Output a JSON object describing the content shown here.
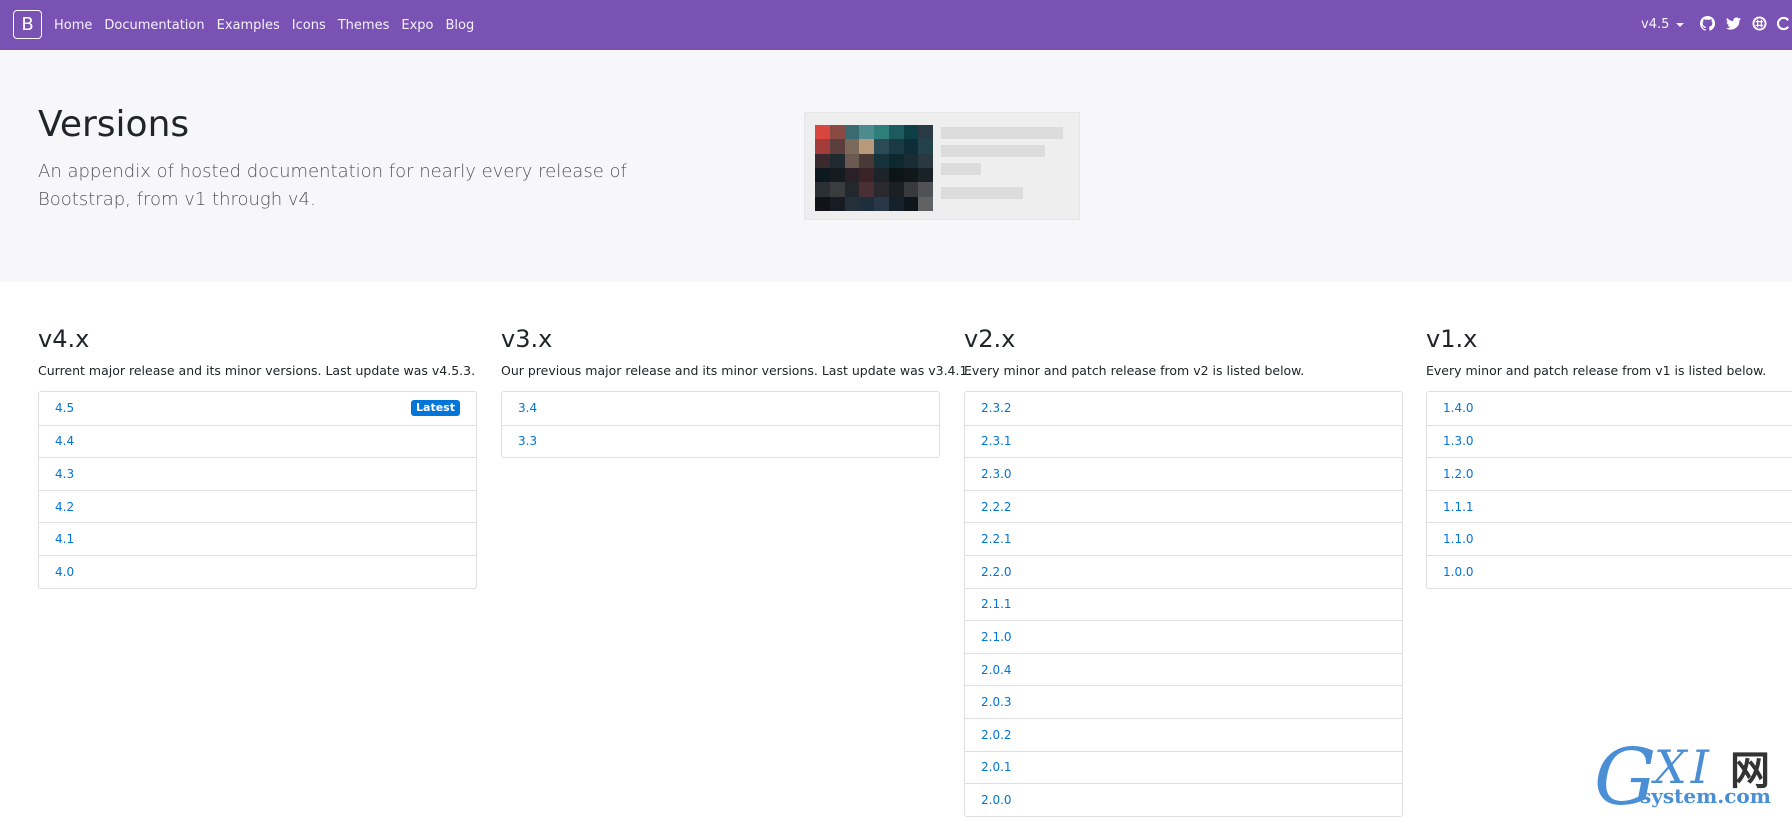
{
  "navbar": {
    "brand": "B",
    "links": [
      "Home",
      "Documentation",
      "Examples",
      "Icons",
      "Themes",
      "Expo",
      "Blog"
    ],
    "version": "v4.5",
    "icons": [
      "github-icon",
      "twitter-icon",
      "slack-icon",
      "opencollective-icon"
    ],
    "bg": "#7952b3"
  },
  "hero": {
    "title": "Versions",
    "lead": "An appendix of hosted documentation for nearly every release of Bootstrap, from v1 through v4."
  },
  "columns": [
    {
      "title": "v4.x",
      "desc": "Current major release and its minor versions. Last update was v4.5.3.",
      "items": [
        "4.5",
        "4.4",
        "4.3",
        "4.2",
        "4.1",
        "4.0"
      ],
      "badge": "Latest"
    },
    {
      "title": "v3.x",
      "desc": "Our previous major release and its minor versions. Last update was v3.4.1.",
      "items": [
        "3.4",
        "3.3"
      ]
    },
    {
      "title": "v2.x",
      "desc": "Every minor and patch release from v2 is listed below.",
      "items": [
        "2.3.2",
        "2.3.1",
        "2.3.0",
        "2.2.2",
        "2.2.1",
        "2.2.0",
        "2.1.1",
        "2.1.0",
        "2.0.4",
        "2.0.3",
        "2.0.2",
        "2.0.1",
        "2.0.0"
      ]
    },
    {
      "title": "v1.x",
      "desc": "Every minor and patch release from v1 is listed below.",
      "items": [
        "1.4.0",
        "1.3.0",
        "1.2.0",
        "1.1.1",
        "1.1.0",
        "1.0.0"
      ]
    }
  ],
  "watermark": {
    "g": "G",
    "xi": "XI",
    "cn": "网",
    "site": "system.com"
  },
  "colors": {
    "link": "#0275d8",
    "badge": "#0275d8",
    "hero_bg": "#f7f7f9"
  }
}
